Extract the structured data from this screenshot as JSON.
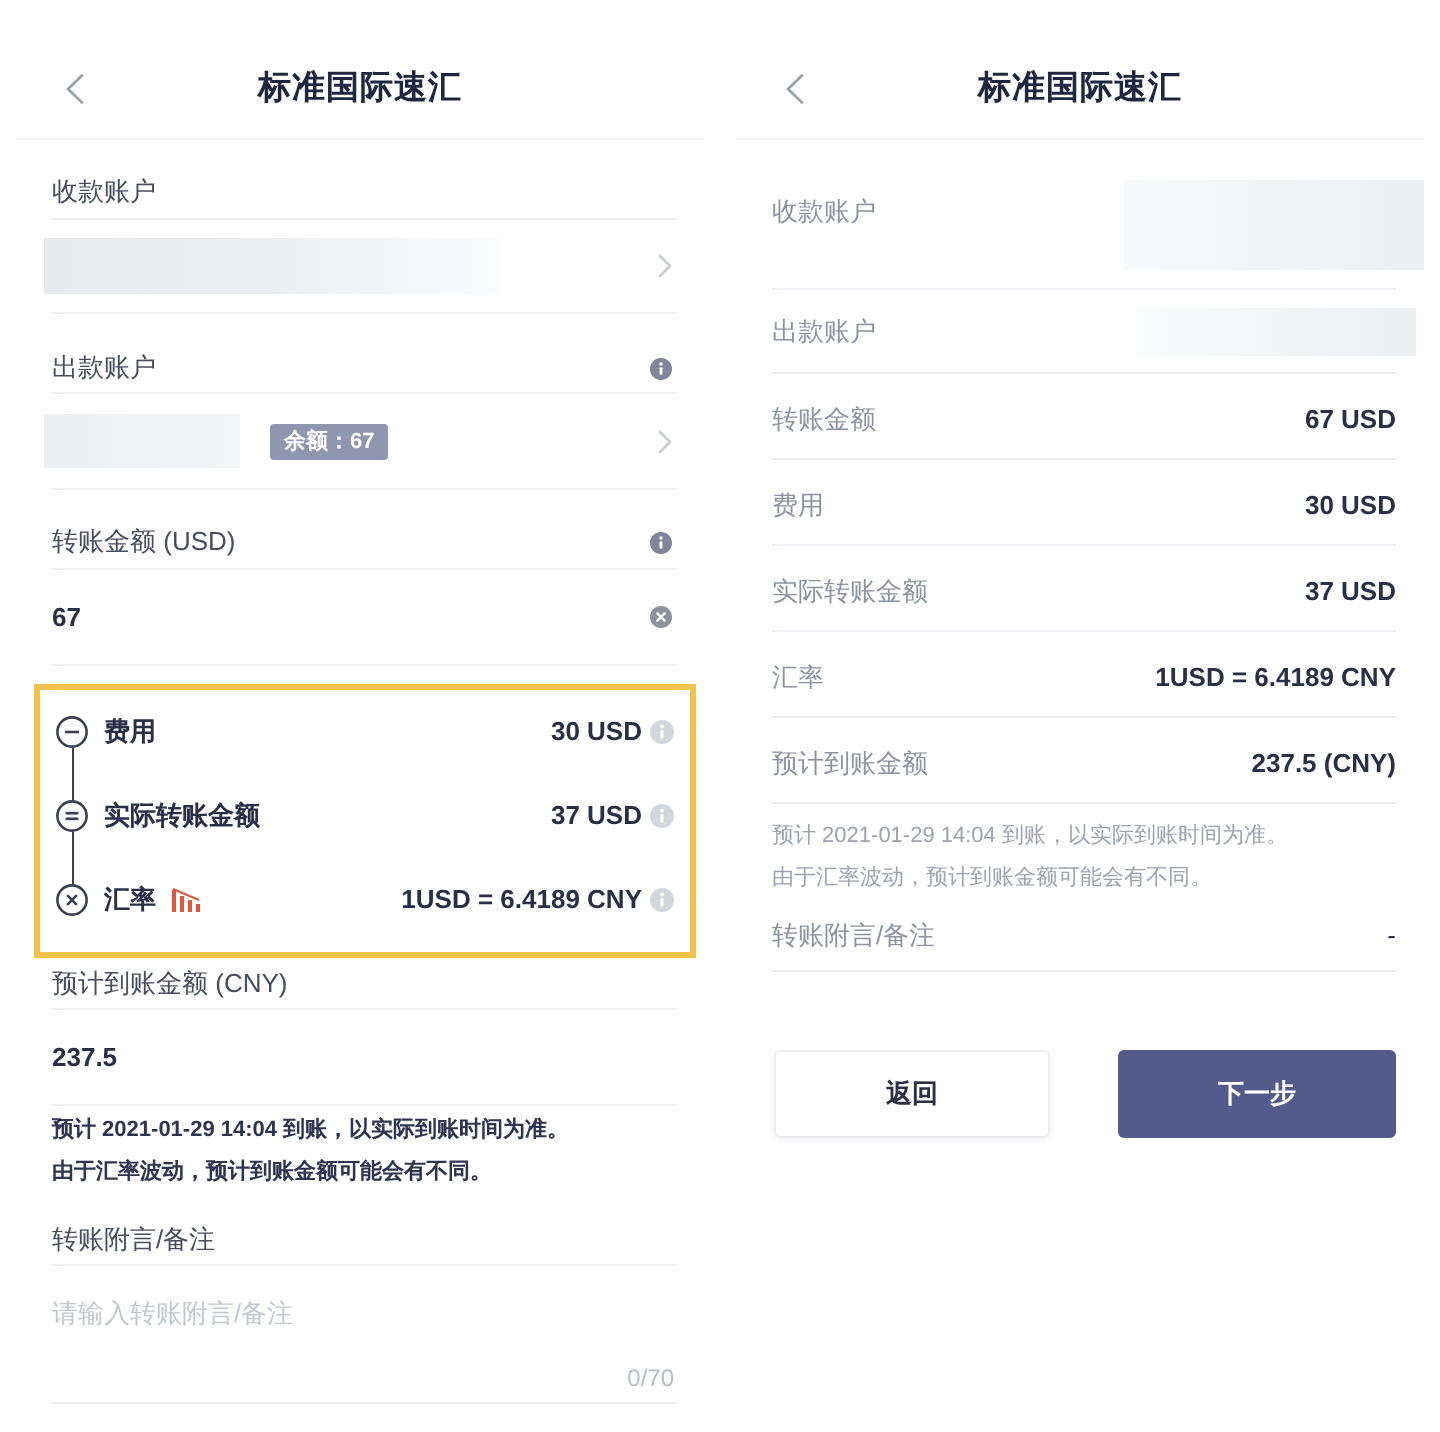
{
  "form_screen": {
    "header": {
      "title": "标准国际速汇"
    },
    "payee_account": {
      "label": "收款账户"
    },
    "payer_account": {
      "label": "出款账户",
      "balance": "余额：67"
    },
    "amount": {
      "label": "转账金额 (USD)",
      "value": "67"
    },
    "breakdown": {
      "highlighted": true,
      "rows": [
        {
          "kind": "minus",
          "label": "费用",
          "value": "30 USD",
          "trend_icon": false
        },
        {
          "kind": "equals",
          "label": "实际转账金额",
          "value": "37 USD",
          "trend_icon": false
        },
        {
          "kind": "times",
          "label": "汇率",
          "value": "1USD = 6.4189 CNY",
          "trend_icon": true
        }
      ]
    },
    "estimated_amount": {
      "label": "预计到账金额 (CNY)",
      "value": "237.5"
    },
    "notes": [
      "预计 2021-01-29 14:04 到账，以实际到账时间为准。",
      "由于汇率波动，预计到账金额可能会有不同。"
    ],
    "remark": {
      "label": "转账附言/备注",
      "placeholder": "请输入转账附言/备注",
      "counter": "0/70"
    }
  },
  "review_screen": {
    "header": {
      "title": "标准国际速汇"
    },
    "payee_account": {
      "label": "收款账户"
    },
    "payer_account": {
      "label": "出款账户"
    },
    "amounts": [
      {
        "label": "转账金额",
        "value": "67 USD"
      },
      {
        "label": "费用",
        "value": "30 USD"
      },
      {
        "label": "实际转账金额",
        "value": "37 USD"
      },
      {
        "label": "汇率",
        "value": "1USD = 6.4189 CNY"
      },
      {
        "label": "预计到账金额",
        "value": "237.5 (CNY)"
      }
    ],
    "notes": [
      "预计 2021-01-29 14:04 到账，以实际到账时间为准。",
      "由于汇率波动，预计到账金额可能会有不同。"
    ],
    "remark": {
      "label": "转账附言/备注",
      "value": "-"
    },
    "buttons": [
      {
        "kind": "secondary",
        "label": "返回"
      },
      {
        "kind": "primary",
        "label": "下一步"
      }
    ]
  }
}
